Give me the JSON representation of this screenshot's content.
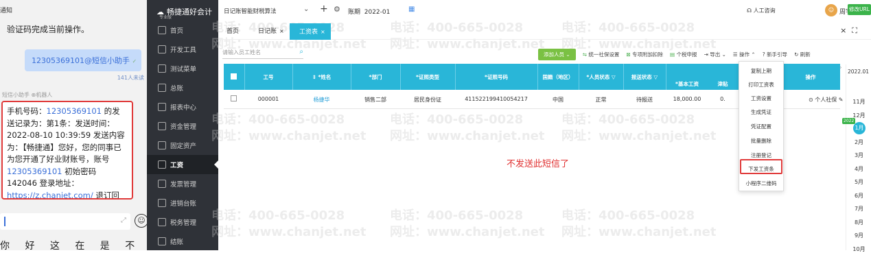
{
  "chat": {
    "notify": "通知",
    "verify_text": "验证码完成当前操作。",
    "bubble": "12305369101@短信小助手",
    "bubble_tick": "✓",
    "unread": "141人未读",
    "sender": "短信小助手",
    "sender_tag": "⊕机器人",
    "message_parts": [
      "手机号码：",
      "12305369101",
      " 的发送记录为：第1条：发送时间：2022-08-10 10:39:59 发送内容为：【畅捷通】您好，您的同事已为您开通了好业财账号，账号 ",
      "12305369101",
      " 初始密码 142046 登录地址：",
      "https://z.chanjet.com/",
      " 退订回 N"
    ],
    "ime_line": "你 好 这 在 是 不 一 今"
  },
  "sidebar": {
    "logo": "畅捷通好会计",
    "logo_sub": "专业版",
    "items": [
      {
        "label": "首页",
        "icon": "home-icon"
      },
      {
        "label": "开发工具",
        "icon": "tools-icon"
      },
      {
        "label": "测试菜单",
        "icon": "menu-icon"
      },
      {
        "label": "总账",
        "icon": "ledger-icon"
      },
      {
        "label": "报表中心",
        "icon": "report-icon"
      },
      {
        "label": "资金管理",
        "icon": "fund-icon"
      },
      {
        "label": "固定资产",
        "icon": "asset-icon"
      },
      {
        "label": "工资",
        "icon": "salary-icon"
      },
      {
        "label": "发票管理",
        "icon": "invoice-icon"
      },
      {
        "label": "进销台账",
        "icon": "inventory-icon"
      },
      {
        "label": "税务管理",
        "icon": "tax-icon"
      },
      {
        "label": "结账",
        "icon": "close-account-icon"
      }
    ],
    "active_index": 7
  },
  "topbar": {
    "book": "日记账智能财税算法",
    "period_label": "账期",
    "period_value": "2022-01",
    "service": "人工咨询",
    "user": "周宇",
    "upgrade": "修改URL"
  },
  "tabs": [
    {
      "label": "首页",
      "closable": false
    },
    {
      "label": "日记账",
      "closable": true
    },
    {
      "label": "工资表",
      "closable": true,
      "active": true
    }
  ],
  "search": {
    "placeholder": "请输入员工姓名"
  },
  "toolbar": {
    "add": "添加人员 ⌄",
    "items": [
      "统一社保设置",
      "专项附加扣除",
      "个税申报",
      "导出 ⌄",
      "操作 ⌃",
      "新手引导",
      "刷新"
    ]
  },
  "table": {
    "headers": [
      "工号",
      "*姓名",
      "*部门",
      "*证照类型",
      "*证照号码",
      "国籍（地区）",
      "*人员状态",
      "报送状态",
      "*基本工资",
      "津贴",
      "操作"
    ],
    "row": {
      "id": "000001",
      "name": "杨捷华",
      "dept": "销售二部",
      "id_type": "居民身份证",
      "id_no": "411522199410054217",
      "nation": "中国",
      "status": "正常",
      "report": "待报送",
      "salary": "18,000.00",
      "allowance": "0.",
      "ops": "个人社保"
    }
  },
  "dropdown": [
    "复制上期",
    "打印工资表",
    "工资设置",
    "生成凭证",
    "凭证配置",
    "批量删除",
    "注册登记",
    "下发工资条",
    "小程序二维码"
  ],
  "note": "不发送此短信了",
  "watermark": {
    "phone": "电话：400-665-0028",
    "site": "网址：www.chanjet.net"
  },
  "calendar": {
    "year_value": "2022.01",
    "year_tag": "2022",
    "months": [
      "11月",
      "12月",
      "1月",
      "2月",
      "3月",
      "4月",
      "5月",
      "6月",
      "7月",
      "8月",
      "9月",
      "10月"
    ],
    "current": "1月"
  },
  "colors": {
    "accent": "#29b6d8",
    "sidebar": "#2f3238",
    "highlight": "#e03a3a",
    "add_button": "#7ac143"
  }
}
